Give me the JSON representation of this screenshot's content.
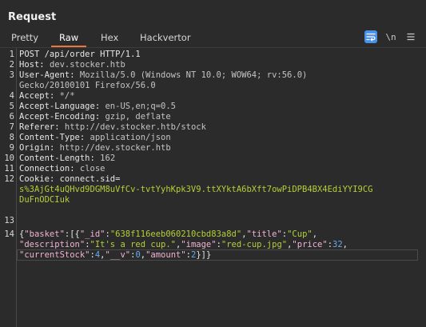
{
  "panel": {
    "title": "Request"
  },
  "tabs": [
    {
      "label": "Pretty",
      "active": false
    },
    {
      "label": "Raw",
      "active": true
    },
    {
      "label": "Hex",
      "active": false
    },
    {
      "label": "Hackvertor",
      "active": false
    }
  ],
  "toolbar": {
    "wrap_icon": "word-wrap-icon",
    "newline_label": "\\n",
    "menu_icon": "hamburger-menu-icon"
  },
  "colors": {
    "accent": "#e8773f",
    "json_key": "#f2b3d4",
    "json_string": "#b5cf3a",
    "json_number": "#66aaf0",
    "wrap_button": "#4a8fe8"
  },
  "request": {
    "line_numbers": [
      "1",
      "2",
      "3",
      "4",
      "5",
      "6",
      "7",
      "8",
      "9",
      "10",
      "11",
      "12",
      "13",
      "14"
    ],
    "request_line": "POST /api/order HTTP/1.1",
    "headers": [
      {
        "key": "Host",
        "value": "dev.stocker.htb"
      },
      {
        "key": "User-Agent",
        "value": "Mozilla/5.0 (Windows NT 10.0; WOW64; rv:56.0)"
      },
      {
        "key": "",
        "value": "Gecko/20100101 Firefox/56.0"
      },
      {
        "key": "Accept",
        "value": "*/*"
      },
      {
        "key": "Accept-Language",
        "value": "en-US,en;q=0.5"
      },
      {
        "key": "Accept-Encoding",
        "value": "gzip, deflate"
      },
      {
        "key": "Referer",
        "value": "http://dev.stocker.htb/stock"
      },
      {
        "key": "Content-Type",
        "value": "application/json"
      },
      {
        "key": "Origin",
        "value": "http://dev.stocker.htb"
      },
      {
        "key": "Content-Length",
        "value": "162"
      },
      {
        "key": "Connection",
        "value": "close"
      }
    ],
    "cookie": {
      "key": "Cookie",
      "name": "connect.sid=",
      "value_line1": "s%3AjGt4uQHvd9DGM8uVfCv-tvtYyhKpk3V9.ttXYktA6bXft7owPiDPB4BX4EdiYYI9CG",
      "value_line2": "DuFnODCIuk"
    },
    "body": {
      "basket_key": "\"basket\"",
      "id_key": "\"_id\"",
      "id_val": "\"638f116eeb060210cbd83a8d\"",
      "title_key": "\"title\"",
      "title_val": "\"Cup\"",
      "desc_key": "\"description\"",
      "desc_val": "\"It's a red cup.\"",
      "image_key": "\"image\"",
      "image_val": "\"red-cup.jpg\"",
      "price_key": "\"price\"",
      "price_val": "32",
      "stock_key": "\"currentStock\"",
      "stock_val": "4",
      "v_key": "\"__v\"",
      "v_val": "0",
      "amount_key": "\"amount\"",
      "amount_val": "2"
    }
  }
}
